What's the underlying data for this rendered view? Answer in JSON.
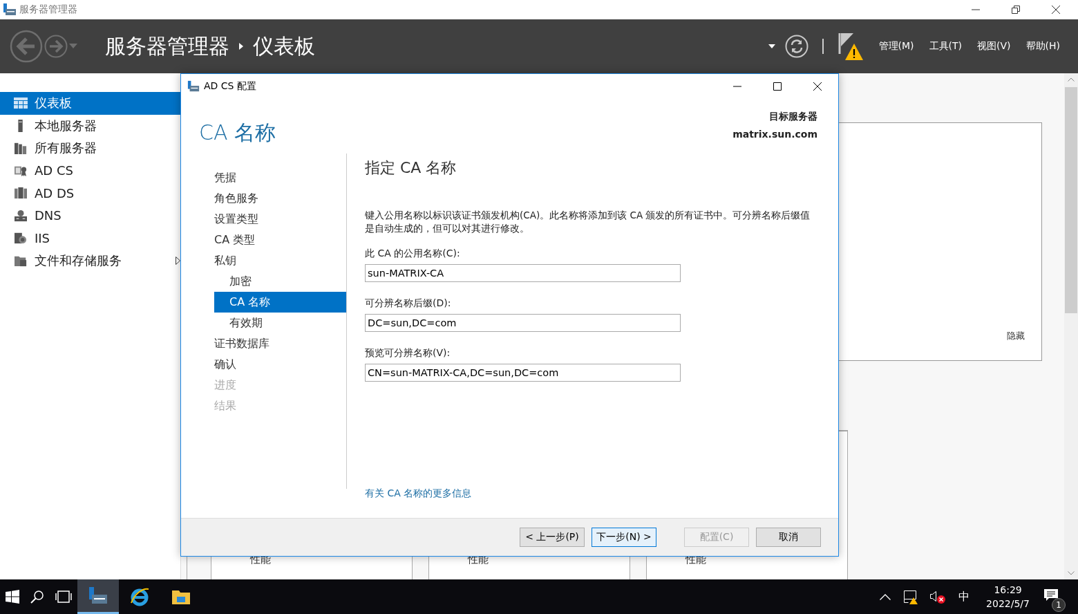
{
  "window": {
    "title": "服务器管理器"
  },
  "header": {
    "breadcrumb": [
      "服务器管理器",
      "仪表板"
    ],
    "menus": [
      "管理(M)",
      "工具(T)",
      "视图(V)",
      "帮助(H)"
    ]
  },
  "sidebar": {
    "items": [
      {
        "label": "仪表板",
        "selected": true,
        "kind": "dashboard"
      },
      {
        "label": "本地服务器",
        "selected": false,
        "kind": "server"
      },
      {
        "label": "所有服务器",
        "selected": false,
        "kind": "servers"
      },
      {
        "label": "AD CS",
        "selected": false,
        "kind": "adcs"
      },
      {
        "label": "AD DS",
        "selected": false,
        "kind": "adds"
      },
      {
        "label": "DNS",
        "selected": false,
        "kind": "dns"
      },
      {
        "label": "IIS",
        "selected": false,
        "kind": "iis"
      },
      {
        "label": "文件和存储服务",
        "selected": false,
        "kind": "files",
        "expandable": true
      }
    ]
  },
  "background": {
    "panel_link": "隐藏",
    "tiles": [
      {
        "label": "性能"
      },
      {
        "label": "性能"
      },
      {
        "label": "性能"
      }
    ]
  },
  "dialog": {
    "title": "AD CS 配置",
    "heading": "CA 名称",
    "target_label": "目标服务器",
    "target_server": "matrix.sun.com",
    "steps": [
      {
        "label": "凭据",
        "selected": false,
        "disabled": false
      },
      {
        "label": "角色服务",
        "selected": false,
        "disabled": false
      },
      {
        "label": "设置类型",
        "selected": false,
        "disabled": false
      },
      {
        "label": "CA 类型",
        "selected": false,
        "disabled": false
      },
      {
        "label": "私钥",
        "selected": false,
        "disabled": false,
        "children": [
          {
            "label": "加密",
            "selected": false,
            "disabled": false
          },
          {
            "label": "CA 名称",
            "selected": true,
            "disabled": false
          },
          {
            "label": "有效期",
            "selected": false,
            "disabled": false
          }
        ]
      },
      {
        "label": "证书数据库",
        "selected": false,
        "disabled": false
      },
      {
        "label": "确认",
        "selected": false,
        "disabled": false
      },
      {
        "label": "进度",
        "selected": false,
        "disabled": true
      },
      {
        "label": "结果",
        "selected": false,
        "disabled": true
      }
    ],
    "section_title": "指定 CA 名称",
    "description": "键入公用名称以标识该证书颁发机构(CA)。此名称将添加到该 CA 颁发的所有证书中。可分辨名称后缀值是自动生成的，但可以对其进行修改。",
    "fields": [
      {
        "label": "此 CA 的公用名称(C):",
        "value": "sun-MATRIX-CA"
      },
      {
        "label": "可分辨名称后缀(D):",
        "value": "DC=sun,DC=com"
      },
      {
        "label": "预览可分辨名称(V):",
        "value": "CN=sun-MATRIX-CA,DC=sun,DC=com"
      }
    ],
    "more_info_link": "有关 CA 名称的更多信息",
    "buttons": [
      {
        "label": "< 上一步(P)",
        "disabled": false,
        "default": false
      },
      {
        "label": "下一步(N) >",
        "disabled": false,
        "default": true
      },
      {
        "label": "配置(C)",
        "disabled": true,
        "default": false
      },
      {
        "label": "取消",
        "disabled": false,
        "default": false
      }
    ]
  },
  "taskbar": {
    "ime": "中",
    "time": "16:29",
    "date": "2022/5/7",
    "notification_count": "1"
  }
}
